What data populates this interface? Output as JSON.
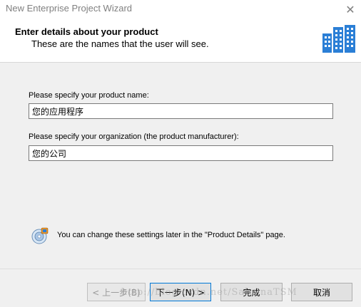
{
  "window": {
    "title": "New Enterprise Project Wizard",
    "close_glyph": "✕"
  },
  "header": {
    "title": "Enter details about your product",
    "subtitle": "These are the names that the user will see.",
    "icon": "building-icon"
  },
  "form": {
    "product_name_label": "Please specify your product name:",
    "product_name_value": "您的应用程序",
    "organization_label": "Please specify your organization (the product manufacturer):",
    "organization_value": "您的公司"
  },
  "info": {
    "icon": "settings-disc-icon",
    "text": "You can change these settings later in the \"Product Details\" page."
  },
  "buttons": {
    "back": "< 上一步(B)",
    "next": "下一步(N) >",
    "finish": "完成",
    "cancel": "取消"
  },
  "watermark": "http://blog.csdn.net/SabrinaTSM",
  "colors": {
    "accent": "#0078d7",
    "icon_blue": "#2b7fd6"
  }
}
